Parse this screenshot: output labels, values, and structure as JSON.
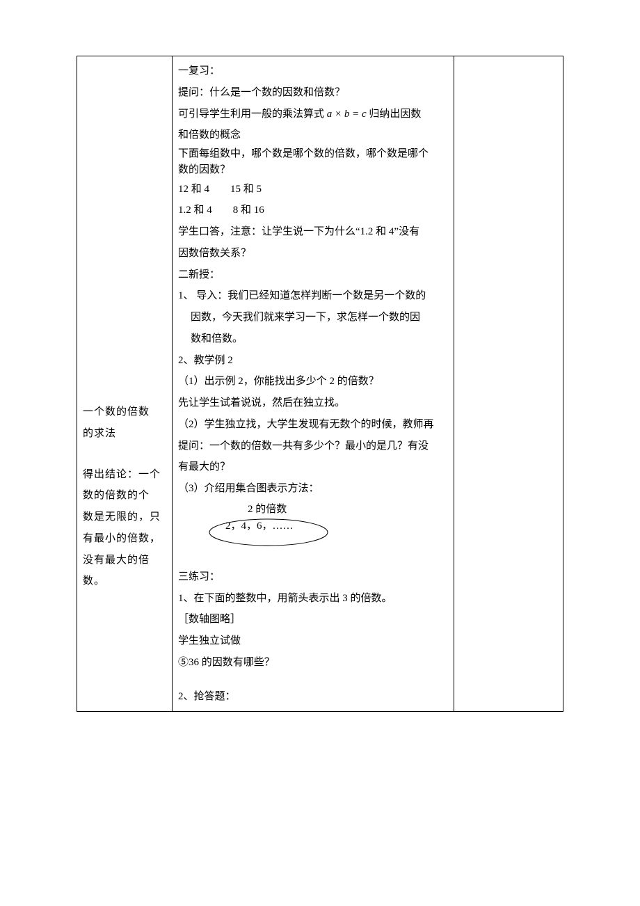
{
  "left": {
    "block1_l1": "一个数的倍数",
    "block1_l2": "的求法",
    "block2_l1": "得出结论：一个",
    "block2_l2": "数的倍数的个",
    "block2_l3": "数是无限的，只",
    "block2_l4": "有最小的倍数，",
    "block2_l5": "没有最大的倍",
    "block2_l6": "数。"
  },
  "mid": {
    "s1_title": "一复习：",
    "s1_q1": "提问：什么是一个数的因数和倍数？",
    "s1_q2a": "可引导学生利用一般的乘法算式 ",
    "s1_q2_math": "a × b = c",
    "s1_q2b": " 归纳出因数",
    "s1_q2c": "和倍数的概念",
    "s1_q3a": "下面每组数中，哪个数是哪个数的倍数，哪个数是哪个",
    "s1_q3b": "数的因数？",
    "s1_pairs1": "12 和 4  15 和 5",
    "s1_pairs2": "1.2 和 4  8 和 16",
    "s1_note_a": "学生口答，注意：让学生说一下为什么“1.2 和 4”没有",
    "s1_note_b": "因数倍数关系？",
    "s2_title": "二新授：",
    "s2_1a": "1、 导入：我们已经知道怎样判断一个数是另一个数的",
    "s2_1b": "因数，今天我们就来学习一下，求怎样一个数的因",
    "s2_1c": "数和倍数。",
    "s2_2": "2、教学例 2",
    "s2_2_1": "（1）出示例 2，你能找出多少个 2 的倍数？",
    "s2_2_1b": "先让学生试着说说，然后在独立找。",
    "s2_2_2a": "（2）学生独立找，大学生发现有无数个的时候，教师再",
    "s2_2_2b": "提问：一个数的倍数一共有多少个？最小的是几？有没",
    "s2_2_2c": "有最大的？",
    "s2_2_3": "（3）介绍用集合图表示方法：",
    "set_label": "2 的倍数",
    "set_content": "2，4，6，……",
    "s3_title": "三练习：",
    "s3_1": "1、在下面的整数中，用箭头表示出 3 的倍数。",
    "s3_1b": "［数轴图略］",
    "s3_1c": "学生独立试做",
    "s3_1d": "⑤36 的因数有哪些？",
    "s3_2": "2、抢答题："
  }
}
